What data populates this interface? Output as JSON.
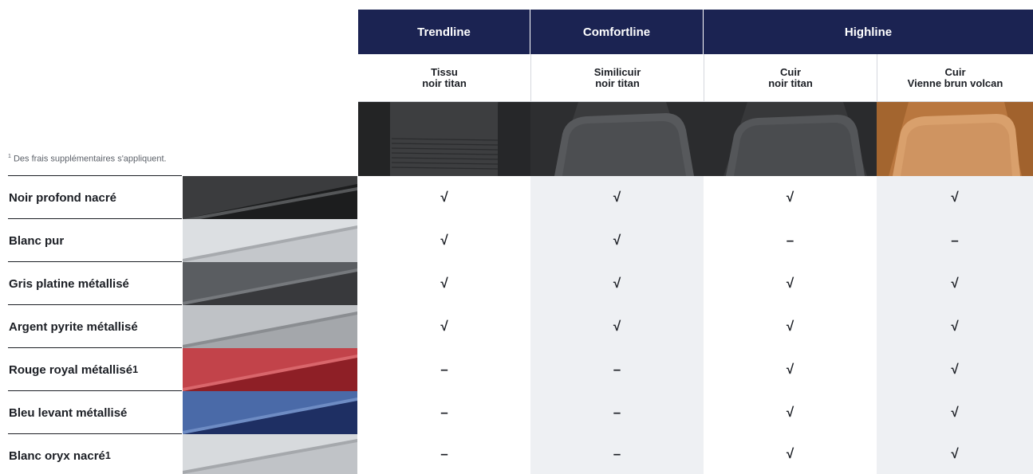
{
  "footnote": "Des frais supplémentaires s'appliquent.",
  "footnote_mark": "1",
  "trims": [
    {
      "label": "Trendline"
    },
    {
      "label": "Comfortline"
    },
    {
      "label": "Highline"
    }
  ],
  "upholsteries": [
    {
      "line1": "Tissu",
      "line2": "noir titan",
      "image_icon": "fabric-seat-image",
      "tone": "#3a3b3d"
    },
    {
      "line1": "Similicuir",
      "line2": "noir titan",
      "image_icon": "leatherette-seat-image",
      "tone": "#4a4b4d"
    },
    {
      "line1": "Cuir",
      "line2": "noir titan",
      "image_icon": "leather-seat-image",
      "tone": "#454648"
    },
    {
      "line1": "Cuir",
      "line2": "Vienne brun volcan",
      "image_icon": "leather-brown-seat-image",
      "tone": "#c98a57"
    }
  ],
  "colors": [
    {
      "name": "Noir profond nacré",
      "sup": "",
      "swatch": "#3b3c3e",
      "marks": [
        "√",
        "√",
        "√",
        "√"
      ]
    },
    {
      "name": "Blanc pur",
      "sup": "",
      "swatch": "#d9dcdf",
      "marks": [
        "√",
        "√",
        "–",
        "–"
      ]
    },
    {
      "name": "Gris platine métallisé",
      "sup": "",
      "swatch": "#55585c",
      "marks": [
        "√",
        "√",
        "√",
        "√"
      ]
    },
    {
      "name": "Argent pyrite métallisé",
      "sup": "",
      "swatch": "#b8bbbf",
      "marks": [
        "√",
        "√",
        "√",
        "√"
      ]
    },
    {
      "name": "Rouge royal métallisé",
      "sup": "1",
      "swatch": "#b4353b",
      "marks": [
        "–",
        "–",
        "√",
        "√"
      ]
    },
    {
      "name": "Bleu levant métallisé",
      "sup": "",
      "swatch": "#3c5d9d",
      "marks": [
        "–",
        "–",
        "√",
        "√"
      ]
    },
    {
      "name": "Blanc oryx nacré",
      "sup": "1",
      "swatch": "#d4d7da",
      "marks": [
        "–",
        "–",
        "√",
        "√"
      ]
    }
  ],
  "accent_color": "#1b2352"
}
